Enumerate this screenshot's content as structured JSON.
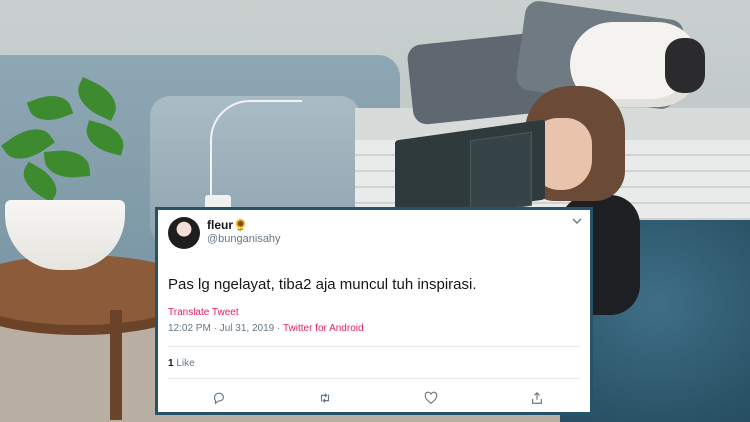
{
  "tweet": {
    "display_name": "fleur",
    "name_emoji": "🌻",
    "handle": "@bunganisahy",
    "text": "Pas lg ngelayat, tiba2 aja muncul tuh inspirasi.",
    "translate_label": "Translate Tweet",
    "time": "12:02 PM",
    "date": "Jul 31, 2019",
    "separator": "·",
    "source": "Twitter for Android",
    "like_count": "1",
    "like_label": "Like"
  },
  "icons": {
    "menu": "chevron-down-icon",
    "reply": "reply-icon",
    "retweet": "retweet-icon",
    "like": "heart-icon",
    "share": "share-icon"
  },
  "colors": {
    "card_border": "#25536a",
    "link": "#e0245e",
    "secondary_text": "#657786",
    "primary_text": "#14171a"
  }
}
